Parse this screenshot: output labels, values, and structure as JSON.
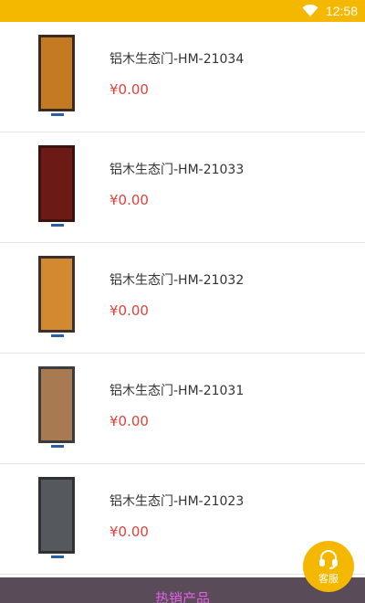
{
  "status_bar": {
    "time": "12:58",
    "wifi_icon": "wifi-icon"
  },
  "products": [
    {
      "name": "铝木生态门-HM-21034",
      "price": "¥0.00",
      "door_color": "#c47a22",
      "frame_color": "#3a2a22"
    },
    {
      "name": "铝木生态门-HM-21033",
      "price": "¥0.00",
      "door_color": "#6b1a16",
      "frame_color": "#3b1210"
    },
    {
      "name": "铝木生态门-HM-21032",
      "price": "¥0.00",
      "door_color": "#d3892f",
      "frame_color": "#3a3030"
    },
    {
      "name": "铝木生态门-HM-21031",
      "price": "¥0.00",
      "door_color": "#a77a52",
      "frame_color": "#3b3b3b"
    },
    {
      "name": "铝木生态门-HM-21023",
      "price": "¥0.00",
      "door_color": "#55585c",
      "frame_color": "#2f3133"
    }
  ],
  "bottom_bar": {
    "label": "热销产品"
  },
  "service_button": {
    "label": "客服",
    "icon": "headset-icon"
  },
  "colors": {
    "accent": "#f5b800",
    "price": "#e0413b",
    "bottom_bar": "#5a4b58",
    "bottom_text": "#e060e6"
  }
}
